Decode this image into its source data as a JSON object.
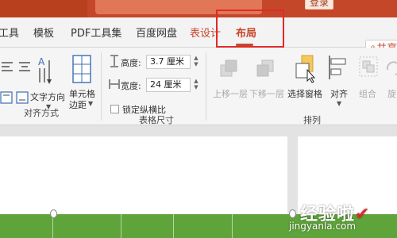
{
  "header": {
    "login_label": "登录"
  },
  "tabs": [
    {
      "label": "工具"
    },
    {
      "label": "模板"
    },
    {
      "label": "PDF工具集"
    },
    {
      "label": "百度网盘"
    },
    {
      "label": "表设计"
    },
    {
      "label": "布局"
    }
  ],
  "share_label": "共享",
  "ribbon": {
    "align_group": {
      "label": "对齐方式",
      "text_direction": "文字方向",
      "cell_margins_line1": "单元格",
      "cell_margins_line2": "边距"
    },
    "size_group": {
      "label": "表格尺寸",
      "height_label": "高度:",
      "height_value": "3.7 厘米",
      "width_label": "宽度:",
      "width_value": "24 厘米",
      "lock_ratio_label": "锁定纵横比"
    },
    "arrange_group": {
      "label": "排列",
      "bring_forward": "上移一层",
      "send_backward": "下移一层",
      "selection_pane": "选择窗格",
      "align": "对齐",
      "group": "组合",
      "rotate": "旋"
    }
  },
  "watermark": {
    "title": "经验啦",
    "url": "jingyanla.com"
  },
  "colors": {
    "accent": "#c5472a",
    "highlight": "#e02a2a",
    "table_green": "#5ea43a"
  }
}
